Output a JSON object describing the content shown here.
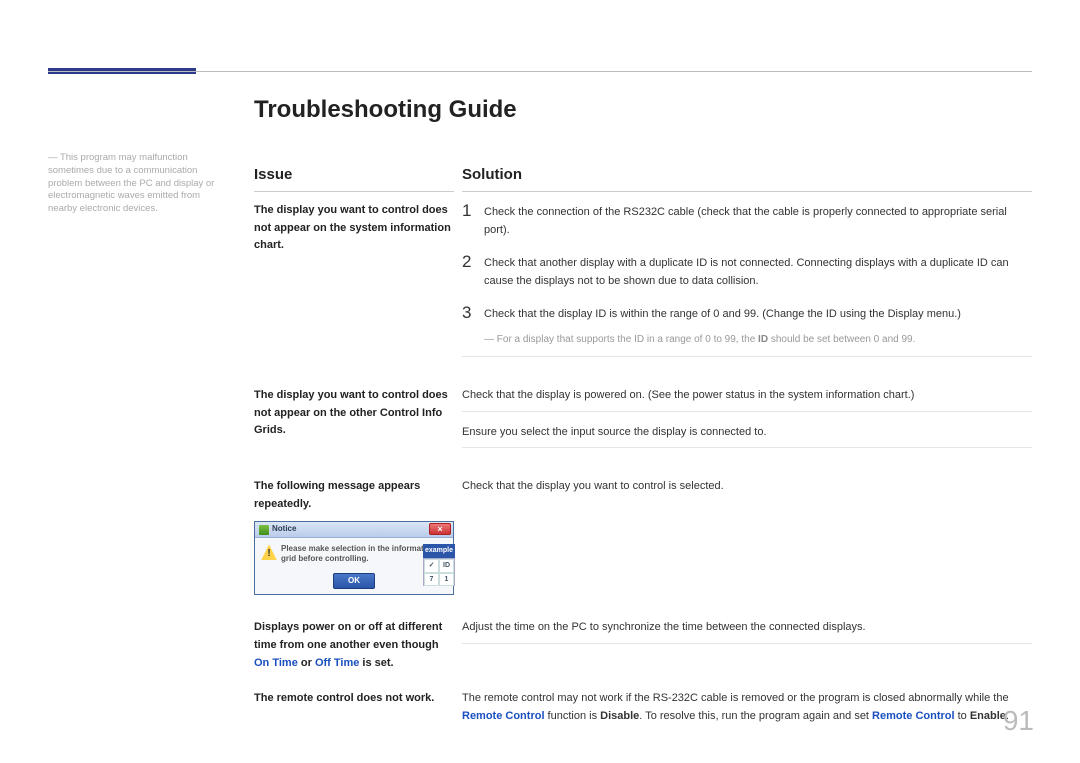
{
  "sidebar_note": "This program may malfunction sometimes due to a communication problem between the PC and display or electromagnetic waves emitted from nearby electronic devices.",
  "page_title": "Troubleshooting Guide",
  "headers": {
    "issue": "Issue",
    "solution": "Solution"
  },
  "row1": {
    "issue": "The display you want to control does not appear on the system information chart.",
    "s1": "Check the connection of the RS232C cable (check that the cable is properly connected to appropriate serial port).",
    "s2": "Check that another display with a duplicate ID is not connected. Connecting displays with a duplicate ID can cause the displays not to be shown due to data collision.",
    "s3": "Check that the display ID is within the range of 0 and 99. (Change the ID using the Display menu.)",
    "note_pre": "For a display that supports the ID in a range of 0 to 99, the ",
    "note_bold": "ID",
    "note_post": " should be set between 0 and 99."
  },
  "row2": {
    "issue": "The display you want to control does not appear on the other Control Info Grids.",
    "s1": "Check that the display is powered on. (See the power status in the system information chart.)",
    "s2": "Ensure you select the input source the display is connected to."
  },
  "row3": {
    "issue": "The following message appears repeatedly.",
    "solution": "Check that the display you want to control is selected.",
    "dialog": {
      "title": "Notice",
      "msg": "Please make selection in the information grid before controlling.",
      "ok": "OK",
      "example": "example",
      "g1": "✓",
      "g2": "ID",
      "g3": "7",
      "g4": "1"
    }
  },
  "row4": {
    "issue_pre": "Displays power on or off at different time from one another even though ",
    "issue_link1": "On Time",
    "issue_mid": " or ",
    "issue_link2": "Off Time",
    "issue_post": " is set.",
    "solution": "Adjust the time on the PC to synchronize the time between the connected displays."
  },
  "row5": {
    "issue": "The remote control does not work.",
    "s_pre": "The remote control may not work if the RS-232C cable is removed or the program is closed abnormally while the ",
    "s_link1": "Remote Control",
    "s_mid1": " function is ",
    "s_bold1": "Disable",
    "s_mid2": ". To resolve this, run the program again and set ",
    "s_link2": "Remote Control",
    "s_mid3": " to ",
    "s_bold2": "Enable",
    "s_post": "."
  },
  "page_number": "91"
}
